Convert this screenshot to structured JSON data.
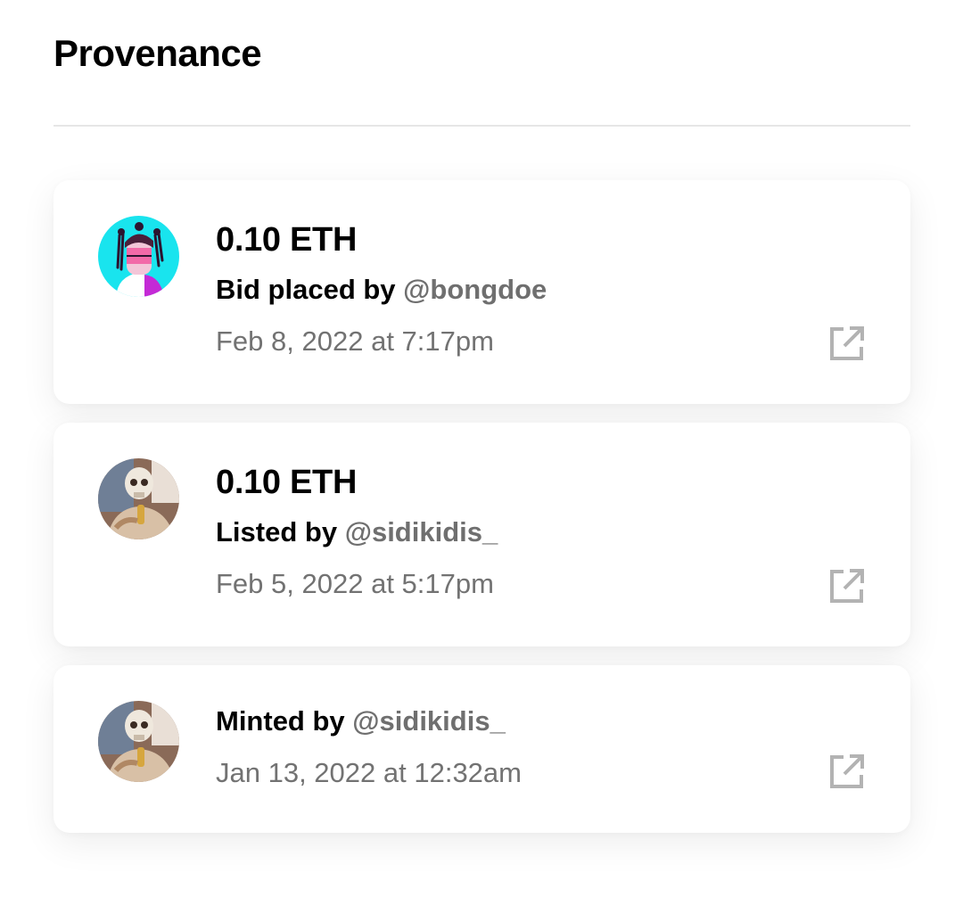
{
  "section": {
    "title": "Provenance"
  },
  "colors": {
    "handle": "#6f6f6f",
    "date": "#727272",
    "icon": "#b3b3b3",
    "divider": "#e6e6e6"
  },
  "events": [
    {
      "amount": "0.10 ETH",
      "action_prefix": "Bid placed by",
      "handle": "@bongdoe",
      "date": "Feb 8, 2022 at 7:17pm",
      "avatar_icon": "avatar-bongdoe",
      "link_icon": "external-link-icon"
    },
    {
      "amount": "0.10 ETH",
      "action_prefix": "Listed by",
      "handle": "@sidikidis_",
      "date": "Feb 5, 2022 at 5:17pm",
      "avatar_icon": "avatar-sidikidis",
      "link_icon": "external-link-icon"
    },
    {
      "action_prefix": "Minted by",
      "handle": "@sidikidis_",
      "date": "Jan 13, 2022 at 12:32am",
      "avatar_icon": "avatar-sidikidis",
      "link_icon": "external-link-icon"
    }
  ]
}
